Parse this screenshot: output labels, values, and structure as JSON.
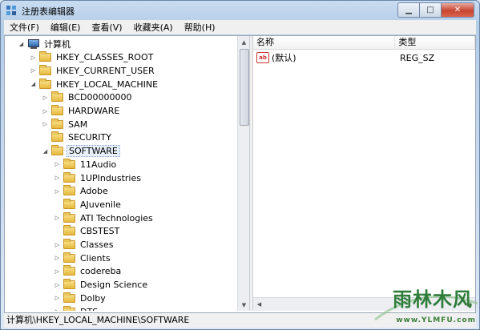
{
  "window": {
    "title": "注册表编辑器",
    "icon": "registry-editor-icon",
    "controls": {
      "minimize": "▁",
      "maximize": "□",
      "close": "✕"
    }
  },
  "menu": [
    "文件(F)",
    "编辑(E)",
    "查看(V)",
    "收藏夹(A)",
    "帮助(H)"
  ],
  "tree": [
    {
      "label": "计算机",
      "level": 0,
      "expander": "expanded",
      "icon": "computer-icon"
    },
    {
      "label": "HKEY_CLASSES_ROOT",
      "level": 1,
      "expander": "collapsed",
      "icon": "folder-icon"
    },
    {
      "label": "HKEY_CURRENT_USER",
      "level": 1,
      "expander": "collapsed",
      "icon": "folder-icon"
    },
    {
      "label": "HKEY_LOCAL_MACHINE",
      "level": 1,
      "expander": "expanded",
      "icon": "folder-icon"
    },
    {
      "label": "BCD00000000",
      "level": 2,
      "expander": "collapsed",
      "icon": "folder-icon"
    },
    {
      "label": "HARDWARE",
      "level": 2,
      "expander": "collapsed",
      "icon": "folder-icon"
    },
    {
      "label": "SAM",
      "level": 2,
      "expander": "collapsed",
      "icon": "folder-icon"
    },
    {
      "label": "SECURITY",
      "level": 2,
      "expander": "none",
      "icon": "folder-icon"
    },
    {
      "label": "SOFTWARE",
      "level": 2,
      "expander": "expanded",
      "icon": "folder-icon",
      "selected": true
    },
    {
      "label": "11Audio",
      "level": 3,
      "expander": "collapsed",
      "icon": "folder-icon"
    },
    {
      "label": "1UPIndustries",
      "level": 3,
      "expander": "collapsed",
      "icon": "folder-icon"
    },
    {
      "label": "Adobe",
      "level": 3,
      "expander": "collapsed",
      "icon": "folder-icon"
    },
    {
      "label": "AJuvenile",
      "level": 3,
      "expander": "none",
      "icon": "folder-icon"
    },
    {
      "label": "ATI Technologies",
      "level": 3,
      "expander": "collapsed",
      "icon": "folder-icon"
    },
    {
      "label": "CBSTEST",
      "level": 3,
      "expander": "none",
      "icon": "folder-icon"
    },
    {
      "label": "Classes",
      "level": 3,
      "expander": "collapsed",
      "icon": "folder-icon"
    },
    {
      "label": "Clients",
      "level": 3,
      "expander": "collapsed",
      "icon": "folder-icon"
    },
    {
      "label": "codereba",
      "level": 3,
      "expander": "collapsed",
      "icon": "folder-icon"
    },
    {
      "label": "Design Science",
      "level": 3,
      "expander": "collapsed",
      "icon": "folder-icon"
    },
    {
      "label": "Dolby",
      "level": 3,
      "expander": "collapsed",
      "icon": "folder-icon"
    },
    {
      "label": "DTS",
      "level": 3,
      "expander": "collapsed",
      "icon": "folder-icon"
    }
  ],
  "list": {
    "columns": {
      "name": "名称",
      "type": "类型"
    },
    "rows": [
      {
        "icon": "string-value-icon",
        "icon_text": "ab",
        "name": "(默认)",
        "type": "REG_SZ"
      }
    ]
  },
  "status": "计算机\\HKEY_LOCAL_MACHINE\\SOFTWARE",
  "watermark": {
    "text": "雨林木风",
    "url": "www.YLMFU.com"
  }
}
